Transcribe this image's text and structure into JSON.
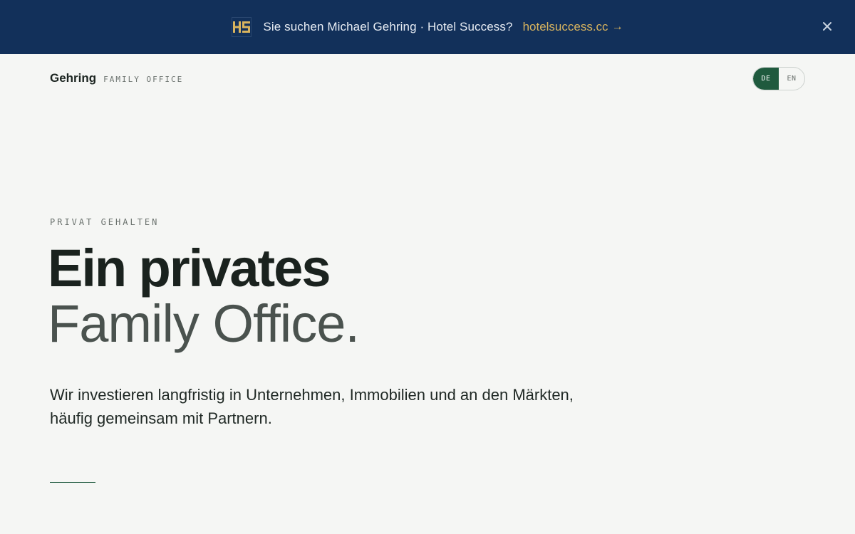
{
  "banner": {
    "logo_text": "HS",
    "text": "Sie suchen Michael Gehring · Hotel Success?",
    "link_label": "hotelsuccess.cc",
    "link_arrow": "→",
    "close_icon": "close-icon",
    "colors": {
      "background": "#12305a",
      "link": "#d9b45e"
    }
  },
  "header": {
    "brand_name": "Gehring",
    "brand_sub": "FAMILY OFFICE",
    "languages": [
      {
        "label": "DE",
        "active": true
      },
      {
        "label": "EN",
        "active": false
      }
    ],
    "accent_color": "#1f5a3e"
  },
  "hero": {
    "eyebrow": "PRIVAT GEHALTEN",
    "headline_line1": "Ein privates",
    "headline_line2": "Family Office.",
    "lead": "Wir investieren langfristig in Unternehmen, Immobilien und an den Märkten, häufig gemeinsam mit Partnern."
  }
}
